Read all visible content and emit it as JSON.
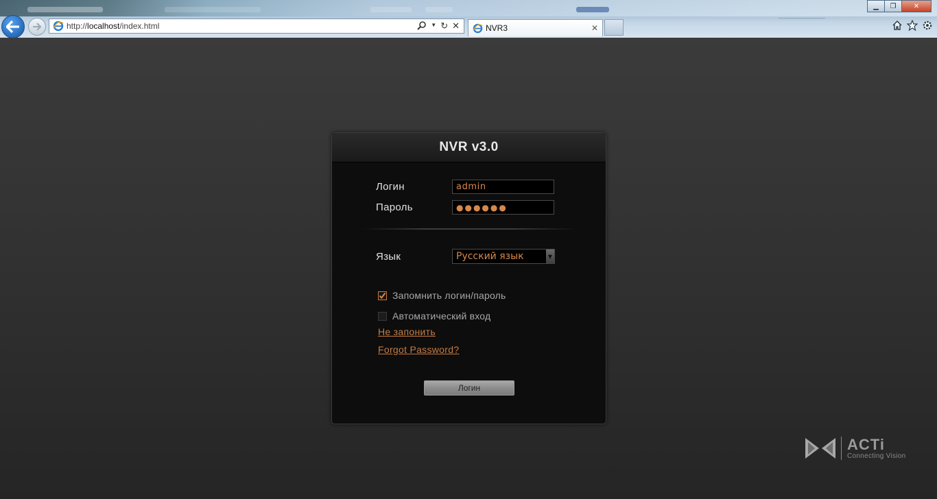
{
  "browser": {
    "address": {
      "prefix": "http://",
      "host": "localhost",
      "path": "/index.html"
    },
    "tab_title": "NVR3",
    "window_buttons": {
      "minimize": "▁",
      "restore": "❐",
      "close": "✕"
    }
  },
  "login": {
    "title": "NVR v3.0",
    "username_label": "Логин",
    "username_value": "admin",
    "password_label": "Пароль",
    "password_value": "●●●●●●",
    "language_label": "Язык",
    "language_value": "Русский язык",
    "remember_label": "Запомнить логин/пароль",
    "remember_checked": true,
    "autologin_label": "Автоматический вход",
    "autologin_checked": false,
    "forget_link": "Не запонить",
    "forgot_password_link": "Forgot Password?",
    "submit_label": "Логин"
  },
  "brand": {
    "name": "ACTi",
    "tagline": "Connecting Vision"
  },
  "colors": {
    "accent": "#d6884a",
    "link": "#c57c45",
    "page_bg": "#2b2b2b",
    "dialog_bg": "#0d0d0d"
  },
  "icons": [
    "back-arrow-icon",
    "forward-arrow-icon",
    "ie-icon",
    "search-icon",
    "refresh-icon",
    "stop-icon",
    "tab-close-icon",
    "home-icon",
    "favorites-icon",
    "settings-icon",
    "checkmark-icon",
    "dropdown-arrow-icon",
    "acti-logo-icon"
  ]
}
